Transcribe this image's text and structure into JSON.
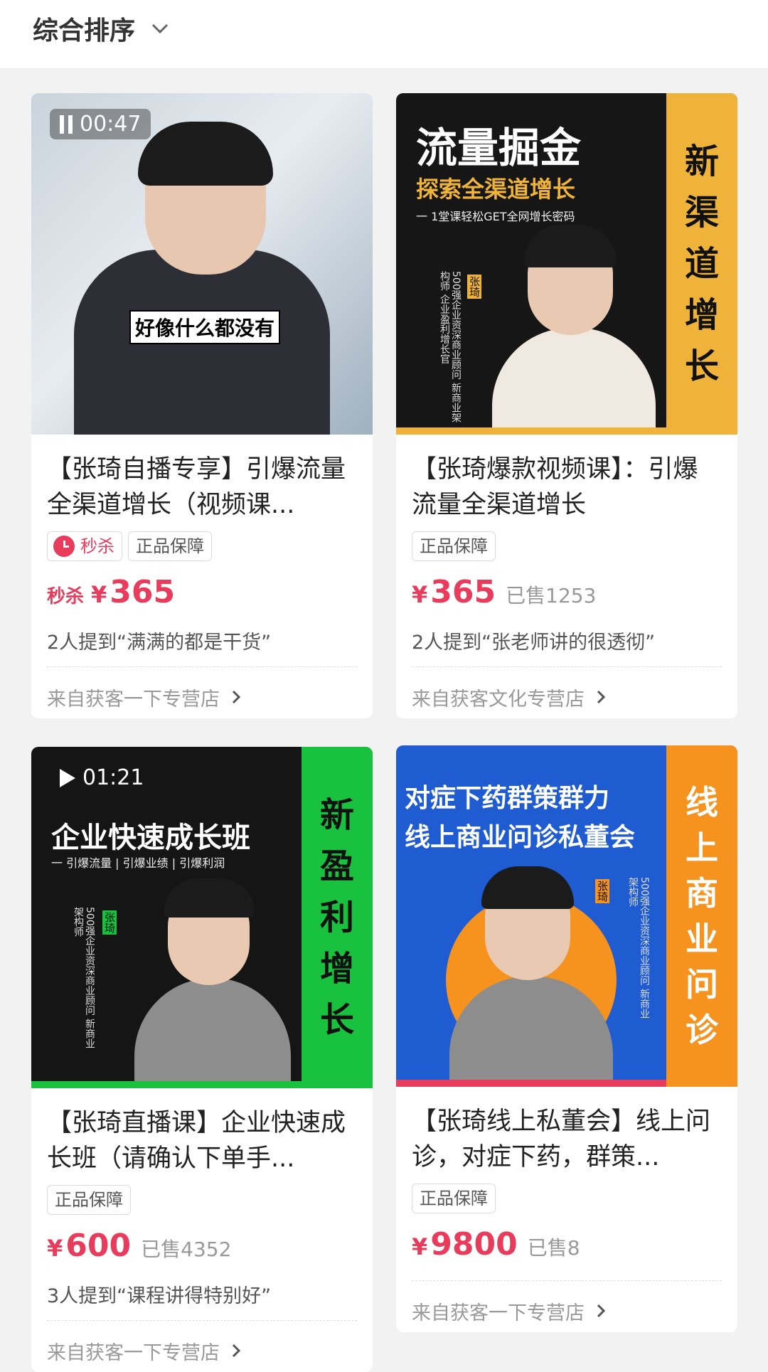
{
  "header": {
    "sort_label": "综合排序"
  },
  "cards": [
    {
      "video_time": "00:47",
      "caption": "好像什么都没有",
      "title": "【张琦自播专享】引爆流量全渠道增长（视频课...",
      "flash_tag": "秒杀",
      "tag": "正品保障",
      "price_prefix": "秒杀",
      "currency": "¥",
      "price": "365",
      "review": "2人提到“满满的都是干货”",
      "shop": "来自获客一下专营店"
    },
    {
      "poster_title": "流量掘金",
      "poster_subtitle": "探索全渠道增长",
      "poster_tagline": "一 1堂课轻松GET全网增长密码",
      "poster_bio": "500强企业资深商业顾问 新商业架构师 企业盈利增长官",
      "poster_name": "张琦",
      "side_text": [
        "新",
        "渠",
        "道",
        "增",
        "长"
      ],
      "title": "【张琦爆款视频课】：引爆流量全渠道增长",
      "tag": "正品保障",
      "currency": "¥",
      "price": "365",
      "sold": "已售1253",
      "review": "2人提到“张老师讲的很透彻”",
      "shop": "来自获客文化专营店"
    },
    {
      "video_time": "01:21",
      "poster_title": "企业快速成长班",
      "poster_tagline": "一 引爆流量 | 引爆业绩 | 引爆利润",
      "poster_bio": "500强企业资深商业顾问 新商业架构师",
      "poster_name": "张琦",
      "side_text": [
        "新",
        "盈",
        "利",
        "增",
        "长"
      ],
      "title": "【张琦直播课】企业快速成长班（请确认下单手...",
      "tag": "正品保障",
      "currency": "¥",
      "price": "600",
      "sold": "已售4352",
      "review": "3人提到“课程讲得特别好”",
      "shop": "来自获客一下专营店"
    },
    {
      "poster_title_line1": "对症下药群策群力",
      "poster_title_line2": "线上商业问诊私董会",
      "poster_bio": "500强企业资深商业顾问 新商业架构师",
      "poster_name": "张琦",
      "side_text": [
        "线",
        "上",
        "商",
        "业",
        "问",
        "诊"
      ],
      "title": "【张琦线上私董会】线上问诊，对症下药，群策...",
      "tag": "正品保障",
      "currency": "¥",
      "price": "9800",
      "sold": "已售8",
      "shop": "来自获客一下专营店"
    }
  ],
  "colors": {
    "accent": "#e93b5b",
    "gold": "#f0b33a",
    "green": "#18c23f",
    "orange": "#f6921e",
    "blue": "#1f5bd1"
  }
}
